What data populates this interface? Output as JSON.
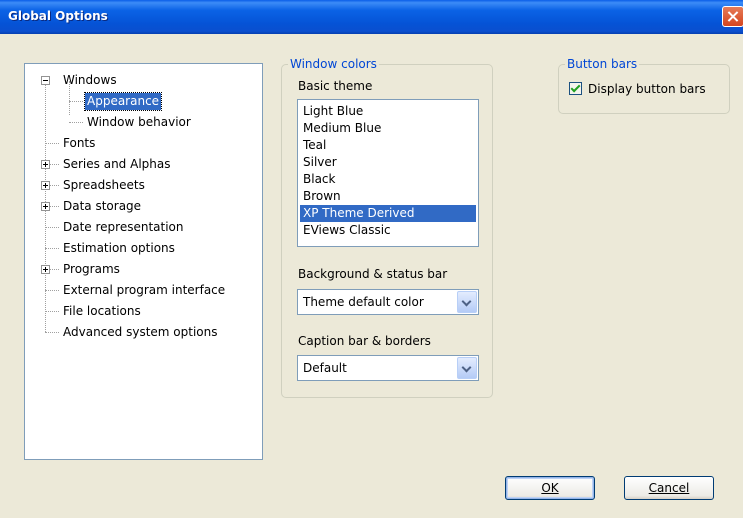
{
  "window": {
    "title": "Global Options"
  },
  "tree": {
    "items": [
      {
        "label": "Windows",
        "expander": "minus"
      },
      {
        "label": "Appearance",
        "selected": true
      },
      {
        "label": "Window behavior"
      },
      {
        "label": "Fonts"
      },
      {
        "label": "Series and Alphas",
        "expander": "plus"
      },
      {
        "label": "Spreadsheets",
        "expander": "plus"
      },
      {
        "label": "Data storage",
        "expander": "plus"
      },
      {
        "label": "Date representation"
      },
      {
        "label": "Estimation options"
      },
      {
        "label": "Programs",
        "expander": "plus"
      },
      {
        "label": "External program interface"
      },
      {
        "label": "File locations"
      },
      {
        "label": "Advanced system options"
      }
    ]
  },
  "window_colors": {
    "group_label": "Window colors",
    "basic_theme_label": "Basic theme",
    "themes": [
      "Light Blue",
      "Medium Blue",
      "Teal",
      "Silver",
      "Black",
      "Brown",
      "XP Theme Derived",
      "EViews Classic"
    ],
    "selected_theme": "XP Theme Derived",
    "background_label": "Background & status bar",
    "background_value": "Theme default color",
    "caption_label": "Caption bar & borders",
    "caption_value": "Default"
  },
  "button_bars": {
    "group_label": "Button bars",
    "checkbox_label": "Display button bars",
    "checked": true
  },
  "buttons": {
    "ok": "OK",
    "cancel": "Cancel"
  },
  "colors": {
    "title_bar": "#0553d6",
    "selection": "#316ac5",
    "group_label": "#0046d5",
    "dialog_bg": "#ece9d8"
  }
}
